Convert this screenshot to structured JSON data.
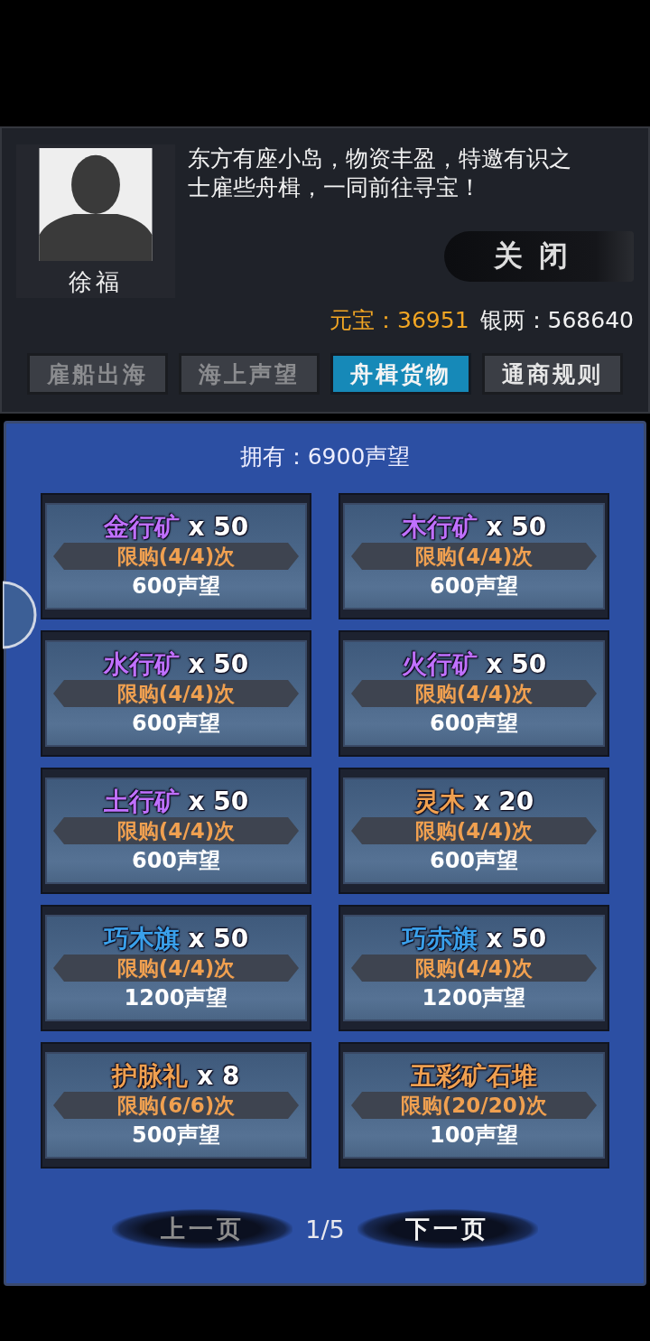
{
  "npc": {
    "name": "徐福",
    "message": "东方有座小岛，物资丰盈，特邀有识之士雇些舟楫，一同前往寻宝！"
  },
  "close_button": "关闭",
  "currency": {
    "gold_label": "元宝：",
    "gold": "36951",
    "silver_label": "银两：",
    "silver": "568640"
  },
  "tabs": [
    {
      "label": "雇船出海",
      "selected": false,
      "disabled": true
    },
    {
      "label": "海上声望",
      "selected": false,
      "disabled": true
    },
    {
      "label": "舟楫货物",
      "selected": true,
      "disabled": false
    },
    {
      "label": "通商规则",
      "selected": false,
      "disabled": false
    }
  ],
  "owned": "拥有：6900声望",
  "items": [
    {
      "name": "金行矿",
      "quantity": " x 50",
      "color": "#c070ff",
      "limit": "限购(4/4)次",
      "price": "600声望"
    },
    {
      "name": "木行矿",
      "quantity": " x 50",
      "color": "#c070ff",
      "limit": "限购(4/4)次",
      "price": "600声望"
    },
    {
      "name": "水行矿",
      "quantity": " x 50",
      "color": "#c070ff",
      "limit": "限购(4/4)次",
      "price": "600声望"
    },
    {
      "name": "火行矿",
      "quantity": " x 50",
      "color": "#c070ff",
      "limit": "限购(4/4)次",
      "price": "600声望"
    },
    {
      "name": "土行矿",
      "quantity": " x 50",
      "color": "#c070ff",
      "limit": "限购(4/4)次",
      "price": "600声望"
    },
    {
      "name": "灵木",
      "quantity": " x 20",
      "color": "#f0a050",
      "limit": "限购(4/4)次",
      "price": "600声望"
    },
    {
      "name": "巧木旗",
      "quantity": " x 50",
      "color": "#3aa0ea",
      "limit": "限购(4/4)次",
      "price": "1200声望"
    },
    {
      "name": "巧赤旗",
      "quantity": " x 50",
      "color": "#3aa0ea",
      "limit": "限购(4/4)次",
      "price": "1200声望"
    },
    {
      "name": "护脉礼",
      "quantity": " x 8",
      "color": "#f0a050",
      "limit": "限购(6/6)次",
      "price": "500声望"
    },
    {
      "name": "五彩矿石堆",
      "color": "#f0a050",
      "limit": "限购(20/20)次",
      "price": "100声望"
    }
  ],
  "pager": {
    "prev": {
      "label": "上一页",
      "disabled": true
    },
    "page": "1/5",
    "next": {
      "label": "下一页",
      "disabled": false
    }
  }
}
